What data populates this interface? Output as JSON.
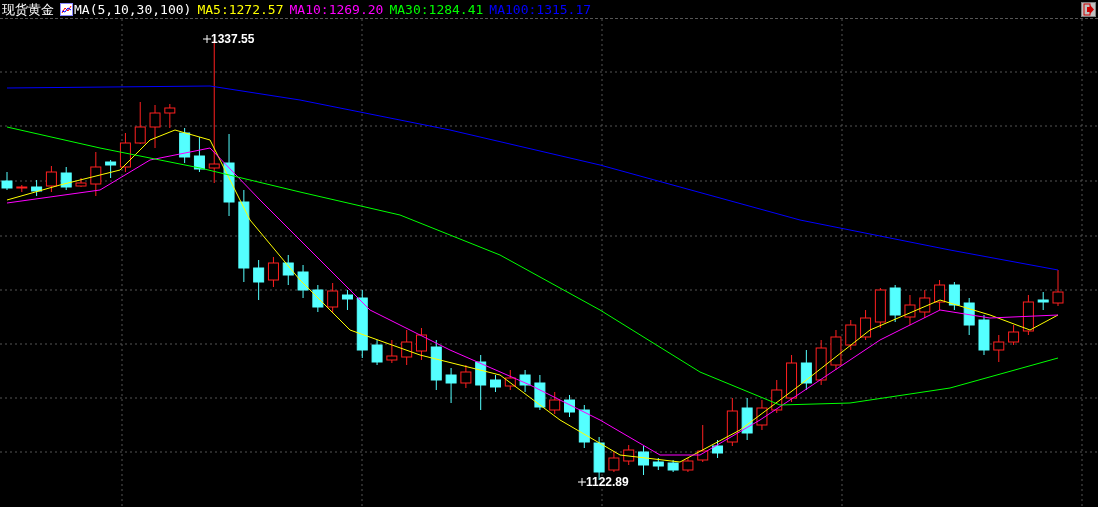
{
  "header": {
    "title": "现货黄金",
    "indicator": "MA(5,10,30,100)",
    "readings": [
      {
        "label": "MA5:1272.57",
        "color": "#ffff00"
      },
      {
        "label": "MA10:1269.20",
        "color": "#ff00ff"
      },
      {
        "label": "MA30:1284.41",
        "color": "#00ff00"
      },
      {
        "label": "MA100:1315.17",
        "color": "#0000ff"
      }
    ]
  },
  "chart": {
    "high_label": "1337.55",
    "low_label": "1122.89"
  }
}
